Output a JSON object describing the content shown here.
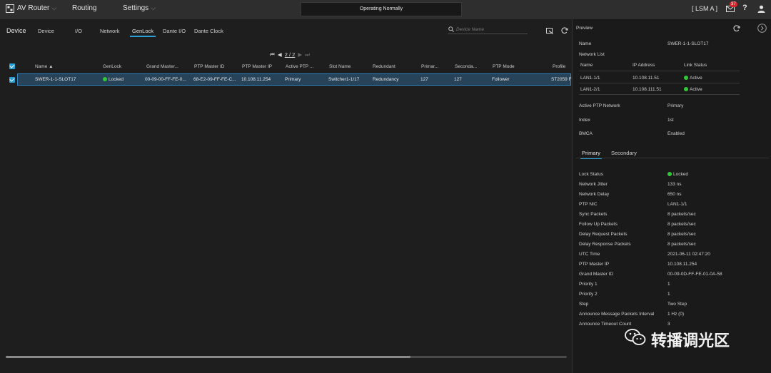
{
  "topbar": {
    "app_name": "AV Router",
    "menu_routing": "Routing",
    "menu_settings": "Settings",
    "status": "Operating Normally",
    "lsm": "[ LSM A ]",
    "mail_count": "37",
    "help": "?"
  },
  "toolbar": {
    "device_label": "Device",
    "tabs": [
      "Device",
      "I/O",
      "Network",
      "GenLock",
      "Dante I/O",
      "Dante Clock"
    ],
    "active_tab": "GenLock",
    "search_placeholder": "Device Name"
  },
  "pager": {
    "text": "2 / 2"
  },
  "table": {
    "columns": [
      "Name ▲",
      "GenLock",
      "Grand Master...",
      "PTP Master ID",
      "PTP Master IP",
      "Active PTP ...",
      "Slot Name",
      "Redundant",
      "Primar...",
      "Seconda...",
      "PTP Mode",
      "Profile"
    ],
    "rows": [
      {
        "name": "SWER-1-1-SLOT17",
        "genlock": "Locked",
        "grand_master": "00-09-00-FF-FE-0...",
        "ptp_master_id": "68-E2-09-FF-FE-C...",
        "ptp_master_ip": "10.108.11.254",
        "active_ptp": "Primary",
        "slot_name": "Switcher1-1/17",
        "redundant": "Redundancy",
        "primary": "127",
        "secondary": "127",
        "ptp_mode": "Follower",
        "profile": "ST2059 F"
      }
    ]
  },
  "preview": {
    "title": "Preview",
    "name_label": "Name",
    "name_value": "SWER-1-1-SLOT17",
    "network_list_label": "Network List",
    "nl_headers": [
      "Name",
      "IP Address",
      "Link Status"
    ],
    "nl_rows": [
      {
        "name": "LAN1-1/1",
        "ip": "10.108.11.51",
        "status": "Active"
      },
      {
        "name": "LAN1-2/1",
        "ip": "10.108.111.51",
        "status": "Active"
      }
    ],
    "info": [
      {
        "label": "Active PTP Network",
        "value": "Primary"
      },
      {
        "label": "Index",
        "value": "1st"
      },
      {
        "label": "BMCA",
        "value": "Enabled"
      }
    ],
    "tabs": [
      "Primary",
      "Secondary"
    ],
    "active_tab": "Primary",
    "details": [
      {
        "label": "Lock Status",
        "value": "Locked"
      },
      {
        "label": "Network Jitter",
        "value": "133 ns"
      },
      {
        "label": "Network Delay",
        "value": "650 ns"
      },
      {
        "label": "PTP NIC",
        "value": "LAN1-1/1"
      },
      {
        "label": "Sync Packets",
        "value": "8 packets/sec"
      },
      {
        "label": "Follow Up Packets",
        "value": "8 packets/sec"
      },
      {
        "label": "Delay Request Packets",
        "value": "8 packets/sec"
      },
      {
        "label": "Delay Response Packets",
        "value": "8 packets/sec"
      },
      {
        "label": "UTC Time",
        "value": "2021-06-11 02:47:20"
      },
      {
        "label": "PTP Master IP",
        "value": "10.108.11.254"
      },
      {
        "label": "Grand Master ID",
        "value": "00-09-0D-FF-FE-01-0A-58"
      },
      {
        "label": "Priority 1",
        "value": "1"
      },
      {
        "label": "Priority 2",
        "value": "1"
      },
      {
        "label": "Step",
        "value": "Two Step"
      },
      {
        "label": "Announce Message Packets Interval",
        "value": "1 Hz (0)"
      },
      {
        "label": "Announce Timeout Count",
        "value": "3"
      }
    ]
  },
  "watermark": {
    "text": "转播调光区"
  },
  "colors": {
    "accent": "#2aa0d8",
    "ok": "#32c738",
    "badge": "#d6262c",
    "selected_row": "#27435a"
  }
}
